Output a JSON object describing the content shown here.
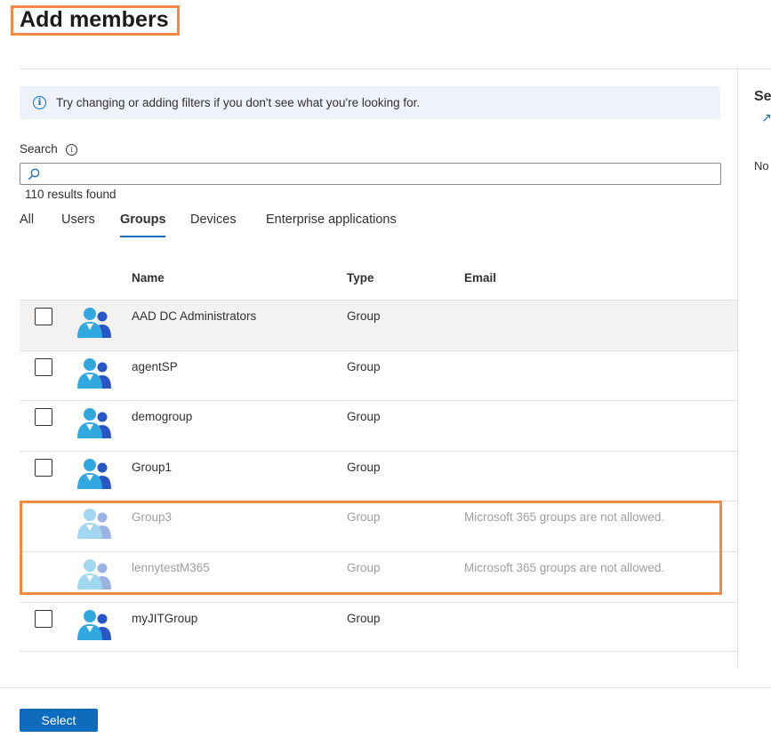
{
  "page": {
    "title": "Add members"
  },
  "info_banner": {
    "text": "Try changing or adding filters if you don't see what you're looking for."
  },
  "search": {
    "label": "Search",
    "placeholder": "",
    "value": "",
    "results_count": "110 results found"
  },
  "tabs": [
    {
      "label": "All",
      "active": false
    },
    {
      "label": "Users",
      "active": false
    },
    {
      "label": "Groups",
      "active": true
    },
    {
      "label": "Devices",
      "active": false
    },
    {
      "label": "Enterprise applications",
      "active": false
    }
  ],
  "table": {
    "headers": {
      "name": "Name",
      "type": "Type",
      "email": "Email"
    },
    "rows": [
      {
        "name": "AAD DC Administrators",
        "type": "Group",
        "email": "",
        "disabled": false,
        "highlighted": true
      },
      {
        "name": "agentSP",
        "type": "Group",
        "email": "",
        "disabled": false,
        "highlighted": false
      },
      {
        "name": "demogroup",
        "type": "Group",
        "email": "",
        "disabled": false,
        "highlighted": false
      },
      {
        "name": "Group1",
        "type": "Group",
        "email": "",
        "disabled": false,
        "highlighted": false
      },
      {
        "name": "Group3",
        "type": "Group",
        "email": "Microsoft 365 groups are not allowed.",
        "disabled": true,
        "highlighted": false
      },
      {
        "name": "lennytestM365",
        "type": "Group",
        "email": "Microsoft 365 groups are not allowed.",
        "disabled": true,
        "highlighted": false
      },
      {
        "name": "myJITGroup",
        "type": "Group",
        "email": "",
        "disabled": false,
        "highlighted": false
      }
    ]
  },
  "right_pane": {
    "title": "Se",
    "text": "No"
  },
  "footer": {
    "select_label": "Select"
  },
  "colors": {
    "accent": "#0f6cbd",
    "highlight_border": "#f28a44",
    "disabled_text": "#a19f9d"
  },
  "icons": {
    "info": "info-icon",
    "search": "search-icon",
    "group": "group-icon"
  }
}
